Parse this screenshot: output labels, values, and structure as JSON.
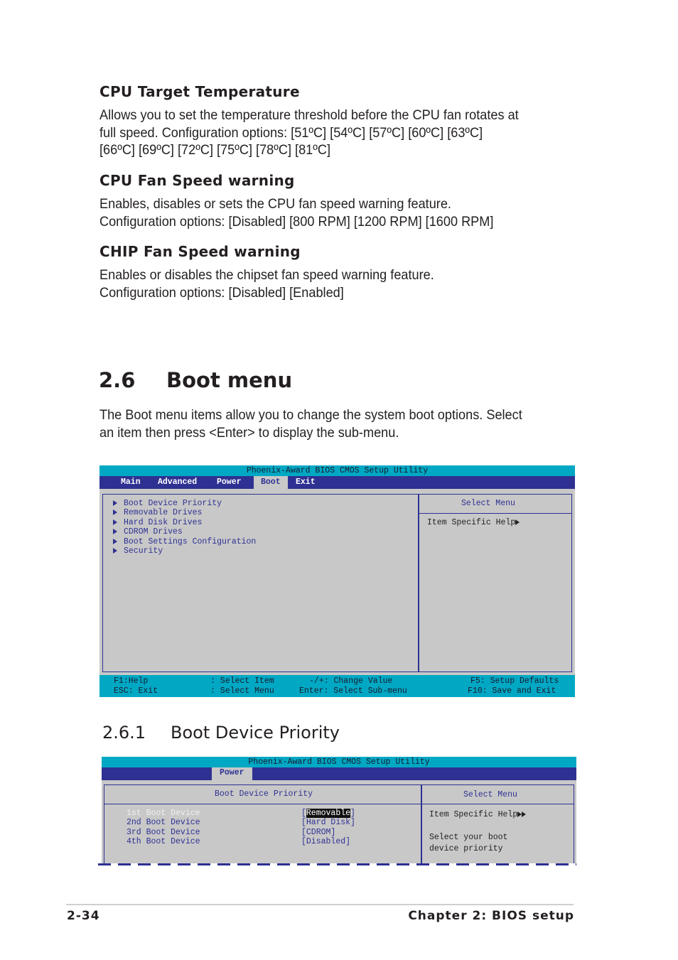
{
  "sections": {
    "cpu_target": {
      "heading": "CPU Target Temperature",
      "lines": [
        "Allows you to set the temperature threshold before the CPU fan rotates at",
        "full speed. Configuration options: [51ºC] [54ºC] [57ºC] [60ºC] [63ºC]",
        "[66ºC] [69ºC] [72ºC] [75ºC] [78ºC] [81ºC]"
      ]
    },
    "cpu_fan": {
      "heading": "CPU Fan Speed warning",
      "lines": [
        "Enables, disables or sets the CPU fan speed warning feature.",
        "Configuration options: [Disabled] [800 RPM] [1200 RPM] [1600 RPM]"
      ]
    },
    "chip_fan": {
      "heading": "CHIP Fan Speed warning",
      "lines": [
        "Enables or disables the chipset fan speed warning feature.",
        "Configuration options: [Disabled] [Enabled]"
      ]
    },
    "boot_menu": {
      "number": "2.6",
      "title": "Boot menu",
      "lines": [
        "The Boot menu items allow you to change the system boot options. Select",
        "an item then press <Enter> to display the sub-menu."
      ]
    },
    "boot_priority": {
      "number": "2.6.1",
      "title": "Boot Device Priority"
    }
  },
  "bios1": {
    "title": "Phoenix-Award BIOS CMOS Setup Utility",
    "tabs": [
      "Main",
      "Advanced",
      "Power",
      "Boot",
      "Exit"
    ],
    "active_tab": "Boot",
    "items": [
      "Boot Device Priority",
      "Removable Drives",
      "Hard Disk Drives",
      "CDROM Drives",
      "Boot Settings Configuration",
      "Security"
    ],
    "side_title": "Select Menu",
    "help": "Item Specific Help",
    "footer": {
      "f1": "F1:Help",
      "f1_desc": ": Select Item",
      "esc": "ESC: Exit",
      "esc_desc": ": Select Menu",
      "pm": "-/+: Change Value",
      "enter": "Enter: Select Sub-menu",
      "f5": "F5: Setup Defaults",
      "f10": "F10: Save and Exit"
    }
  },
  "bios2": {
    "title": "Phoenix-Award BIOS CMOS Setup Utility",
    "active_tab": "Power",
    "panel_title": "Boot Device Priority",
    "side_title": "Select Menu",
    "help": "Item Specific Help",
    "help_text": [
      "Select your boot",
      "device priority"
    ],
    "rows": [
      {
        "label": "1st Boot Device",
        "value": "Removable",
        "selected": true
      },
      {
        "label": "2nd Boot Device",
        "value": "Hard Disk"
      },
      {
        "label": "3rd Boot Device",
        "value": "CDROM"
      },
      {
        "label": "4th Boot Device",
        "value": "Disabled"
      }
    ]
  },
  "footer": {
    "page": "2-34",
    "chapter": "Chapter 2: BIOS setup"
  }
}
